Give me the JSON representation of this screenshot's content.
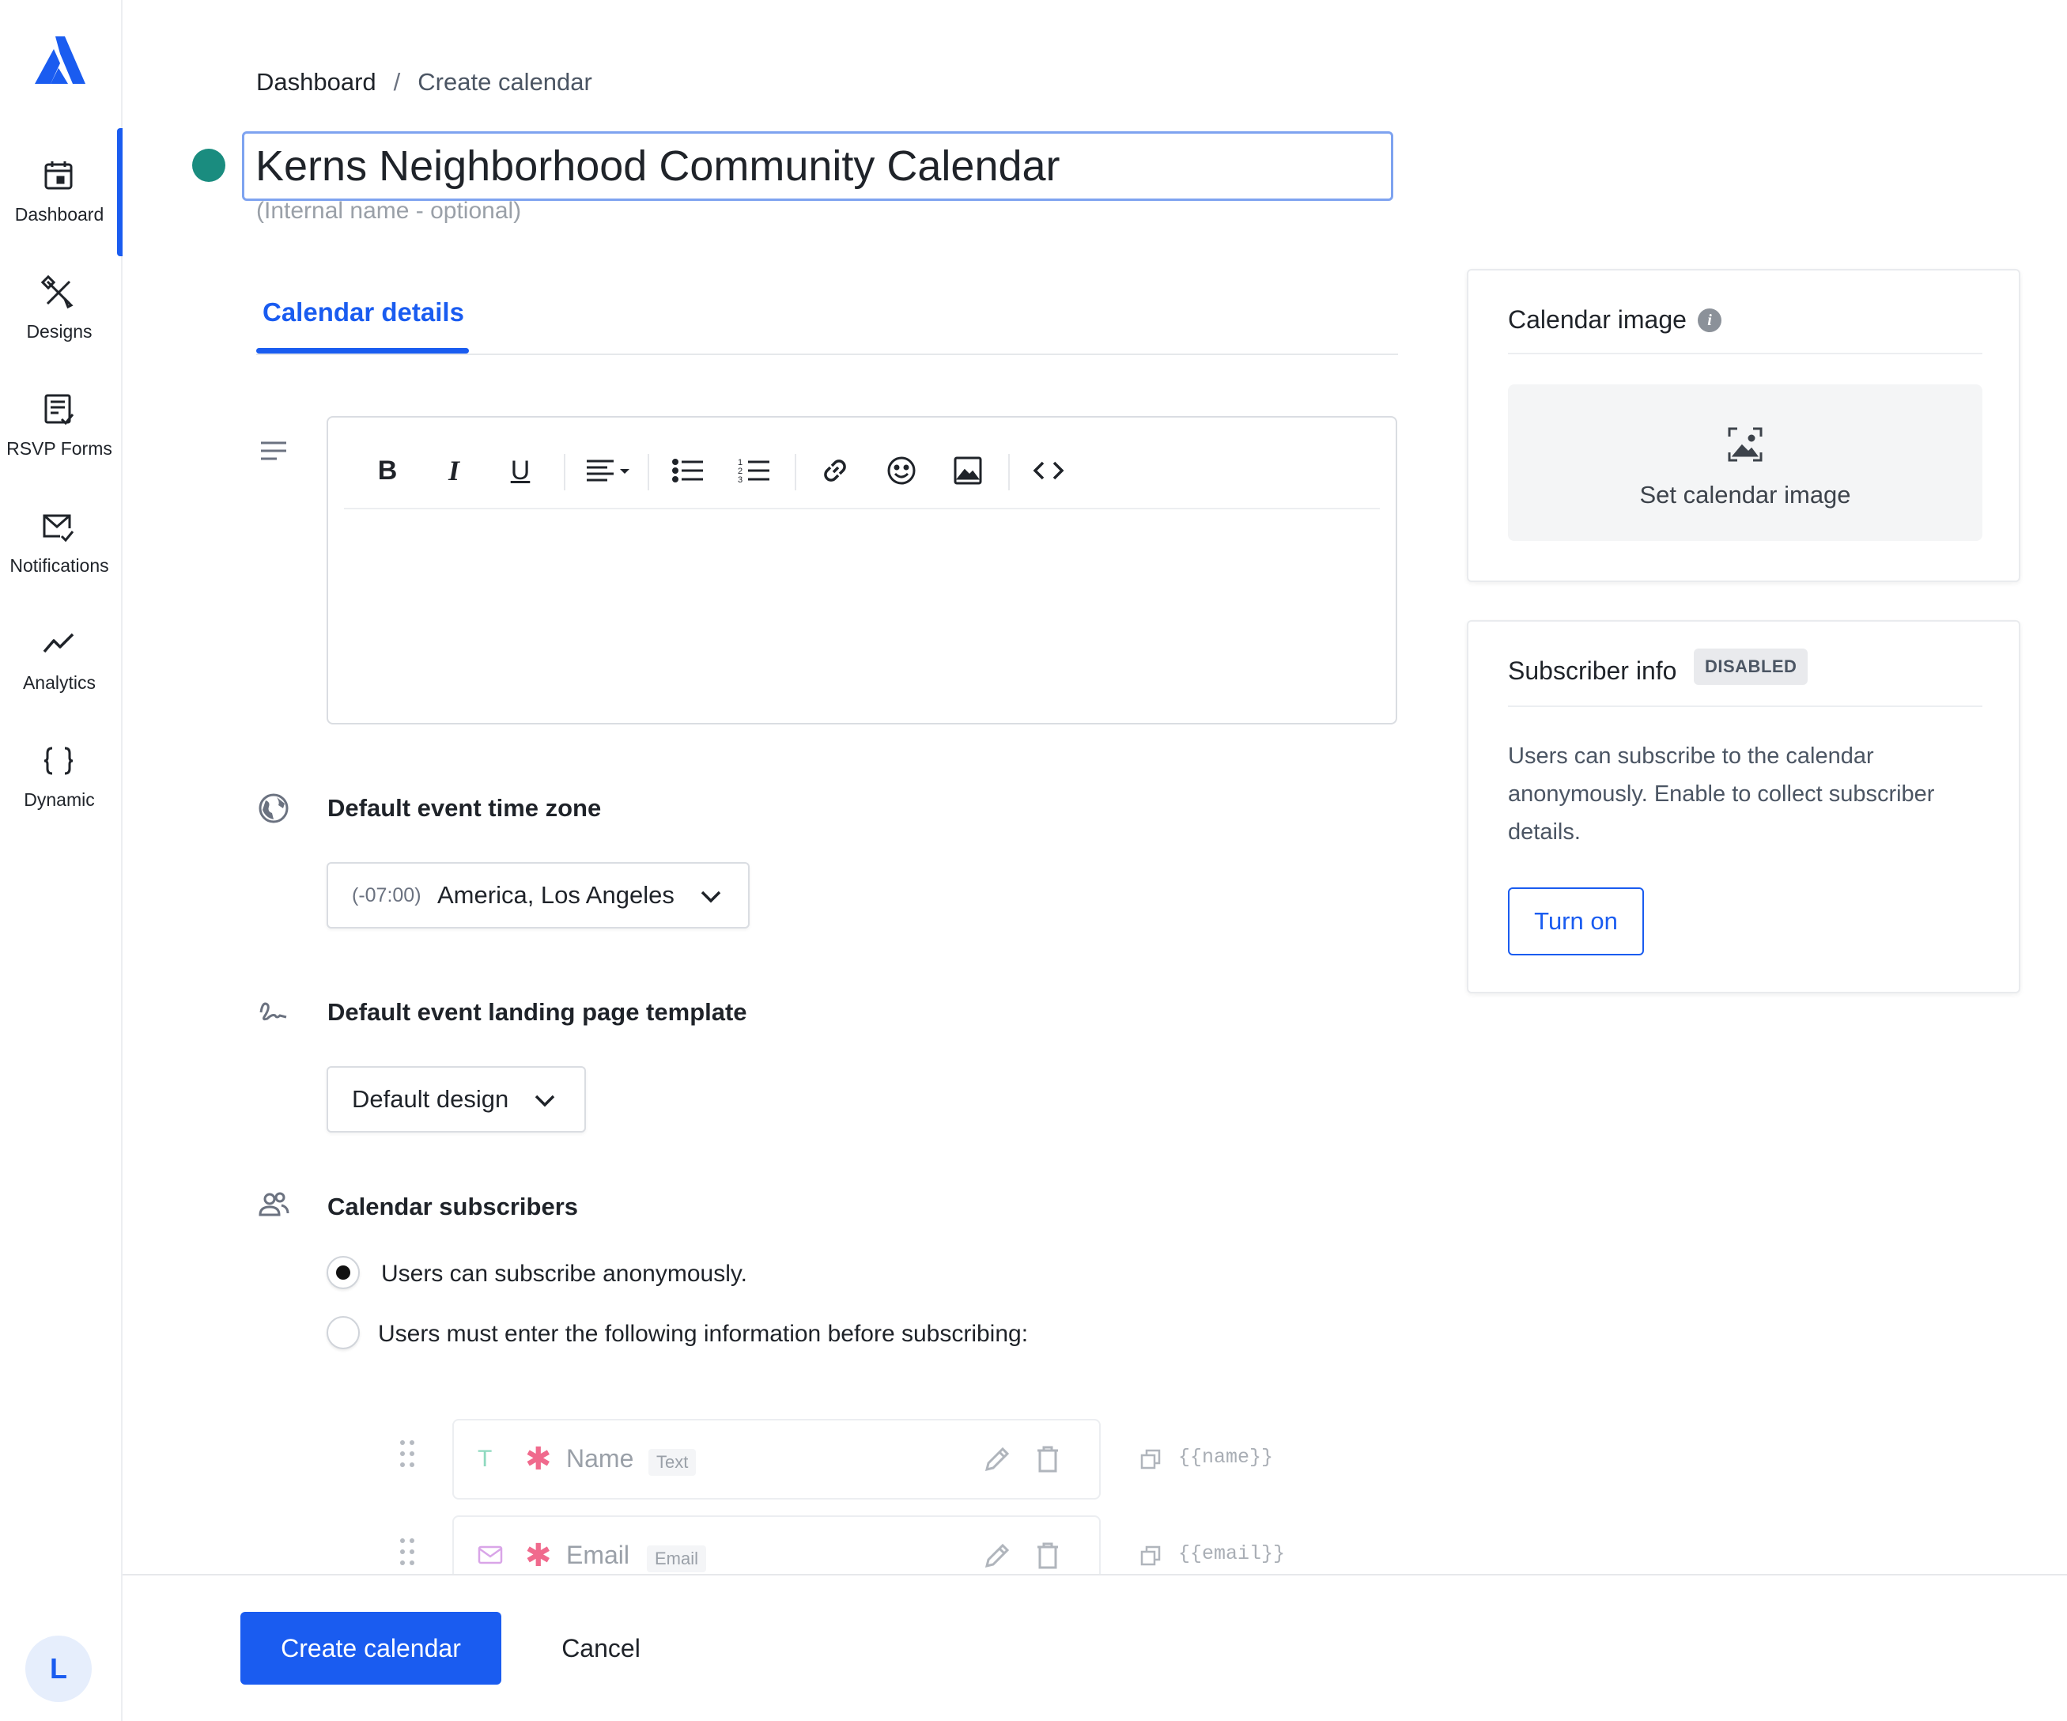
{
  "sidebar": {
    "logo_icon": "brand-logo-icon",
    "items": [
      {
        "label": "Dashboard",
        "icon": "calendar-icon",
        "active": true
      },
      {
        "label": "Designs",
        "icon": "designs-icon"
      },
      {
        "label": "RSVP Forms",
        "icon": "form-icon"
      },
      {
        "label": "Notifications",
        "icon": "mail-check-icon"
      },
      {
        "label": "Analytics",
        "icon": "analytics-icon"
      },
      {
        "label": "Dynamic",
        "icon": "braces-icon"
      }
    ],
    "avatar_initial": "L"
  },
  "breadcrumb": {
    "home": "Dashboard",
    "separator": "/",
    "current": "Create calendar"
  },
  "title": {
    "value": "Kerns Neighborhood Community Calendar",
    "status_color": "#1a8c7f"
  },
  "internal_name_placeholder": "(Internal name - optional)",
  "tabs": [
    {
      "label": "Calendar details",
      "active": true
    }
  ],
  "editor": {
    "toolbar": [
      "bold",
      "italic",
      "underline",
      "align",
      "bullet-list",
      "numbered-list",
      "link",
      "emoji",
      "image",
      "code"
    ],
    "content": ""
  },
  "timezone": {
    "heading": "Default event time zone",
    "offset": "(-07:00)",
    "value": "America, Los Angeles"
  },
  "template": {
    "heading": "Default event landing page template",
    "value": "Default design"
  },
  "subscribers": {
    "heading": "Calendar subscribers",
    "options": [
      {
        "label": "Users can subscribe anonymously.",
        "checked": true
      },
      {
        "label": "Users must enter the following information before subscribing:",
        "checked": false
      }
    ],
    "fields": [
      {
        "name": "Name",
        "type": "Text",
        "type_icon": "T",
        "required": true,
        "tag": "{{name}}"
      },
      {
        "name": "Email",
        "type": "Email",
        "type_icon": "envelope-icon",
        "required": true,
        "tag": "{{email}}"
      }
    ]
  },
  "calendar_image": {
    "title": "Calendar image",
    "action": "Set calendar image"
  },
  "subscriber_info": {
    "title": "Subscriber info",
    "badge": "DISABLED",
    "description": "Users can subscribe to the calendar anonymously. Enable to collect subscriber details.",
    "button": "Turn on"
  },
  "footer": {
    "primary": "Create calendar",
    "secondary": "Cancel"
  },
  "colors": {
    "accent": "#1a5cf0",
    "status": "#1a8c7f",
    "required": "#f06a8d"
  }
}
